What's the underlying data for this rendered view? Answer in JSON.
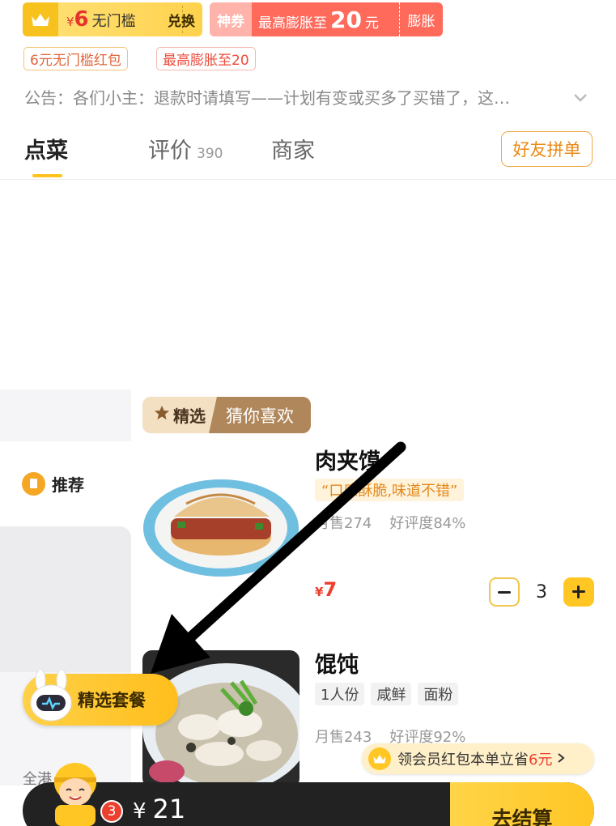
{
  "coupon_gold": {
    "currency": "¥",
    "amount": "6",
    "desc": "无门槛",
    "action": "兑换"
  },
  "coupon_red": {
    "tag": "神券",
    "text_prefix": "最高膨胀至",
    "amount": "20",
    "unit": "元",
    "action": "膨胀"
  },
  "pills": {
    "coupon": "6元无门槛红包",
    "inflate": "最高膨胀至20"
  },
  "notice": "公告：各们小主：退款时请填写——计划有变或买多了买错了，这…",
  "tabs": {
    "order": "点菜",
    "review": "评价",
    "review_count": "390",
    "merchant": "商家",
    "group_order": "好友拼单"
  },
  "sidebar": {
    "recommend": "推荐",
    "cut_item": "全港"
  },
  "section": {
    "badge_left": "精选",
    "badge_right": "猜你喜欢"
  },
  "dishes": [
    {
      "name": "肉夹馍",
      "quote": "“口感酥脆,味道不错”",
      "sold": "月售274",
      "rating": "好评度84%",
      "currency": "¥",
      "price": "7",
      "quantity": "3"
    },
    {
      "name": "馄饨",
      "tags": [
        "1人份",
        "咸鲜",
        "面粉"
      ],
      "sold": "月售243",
      "rating": "好评度92%"
    }
  ],
  "set_meal": "精选套餐",
  "member_banner": {
    "prefix": "领会员红包本单立省",
    "amount": "6元"
  },
  "cart": {
    "badge": "3",
    "currency": "¥",
    "total": "21",
    "checkout": "去结算"
  },
  "colors": {
    "accent_yellow": "#ffc624",
    "price_red": "#ec3f2d",
    "coupon_red": "#ff6a5b",
    "badge_brown": "#b0875b"
  },
  "icons": [
    "crown-icon",
    "chevron-down-icon",
    "star-icon",
    "recommend-icon",
    "minus-icon",
    "plus-icon",
    "robot-icon",
    "courier-icon",
    "chevron-right-icon"
  ]
}
